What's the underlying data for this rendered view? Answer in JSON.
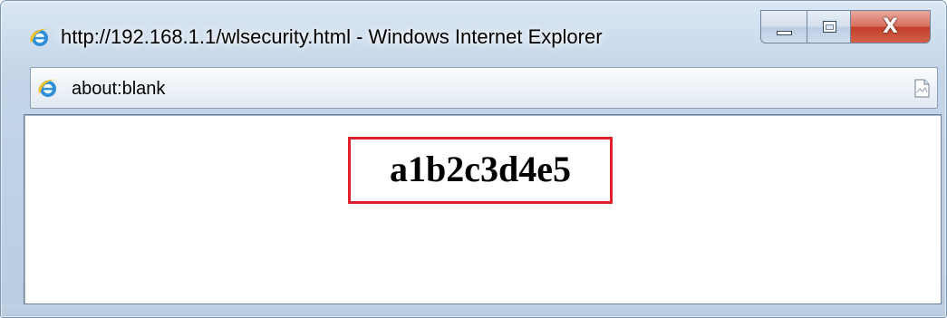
{
  "window": {
    "title": "http://192.168.1.1/wlsecurity.html - Windows Internet Explorer",
    "icon": "ie-logo-icon",
    "buttons": {
      "minimize_icon": "minimize-icon",
      "maximize_icon": "maximize-icon",
      "close_icon": "close-icon",
      "close_glyph": "X"
    }
  },
  "address_bar": {
    "icon": "ie-logo-icon",
    "url": "about:blank",
    "page_icon": "page-icon"
  },
  "content": {
    "key_text": "a1b2c3d4e5"
  },
  "colors": {
    "highlight_border": "#e0202a",
    "close_button": "#c2402a",
    "ie_logo_blue": "#2f8fd8",
    "ie_logo_ring": "#f2c230"
  }
}
